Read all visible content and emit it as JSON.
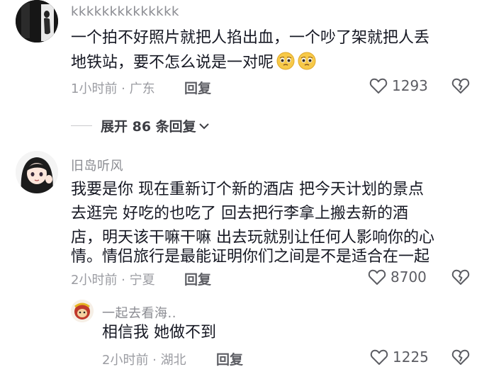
{
  "comments": [
    {
      "username": "kkkkkkkkkkkkkk",
      "lines": [
        "一个拍不好照片就把人掐出血，一个吵了架就把人丢",
        "地铁站，要不怎么说是一对呢"
      ],
      "emojis": [
        "pleading-face-emoji",
        "pleading-face-emoji"
      ],
      "time_location": "1小时前 · 广东",
      "reply_label": "回复",
      "likes": "1293",
      "expand_label": "展开 86 条回复"
    },
    {
      "username": "旧岛听风",
      "lines": [
        "我要是你 现在重新订个新的酒店 把今天计划的景点",
        "去逛完 好吃的也吃了 回去把行李拿上搬去新的酒",
        "店，明天该干嘛干嘛 出去玩就别让任何人影响你的心",
        "情。情侣旅行是最能证明你们之间是不是适合在一起"
      ],
      "time_location": "2小时前 · 宁夏",
      "reply_label": "回复",
      "likes": "8700"
    },
    {
      "username": "一起去看海..",
      "lines": [
        "相信我 她做不到"
      ],
      "time_location": "2小时前 · 湖北",
      "reply_label": "回复",
      "likes": "1225"
    }
  ],
  "colors": {
    "username": "#8a8b91",
    "text": "#161823",
    "meta": "#9b9ca2"
  }
}
